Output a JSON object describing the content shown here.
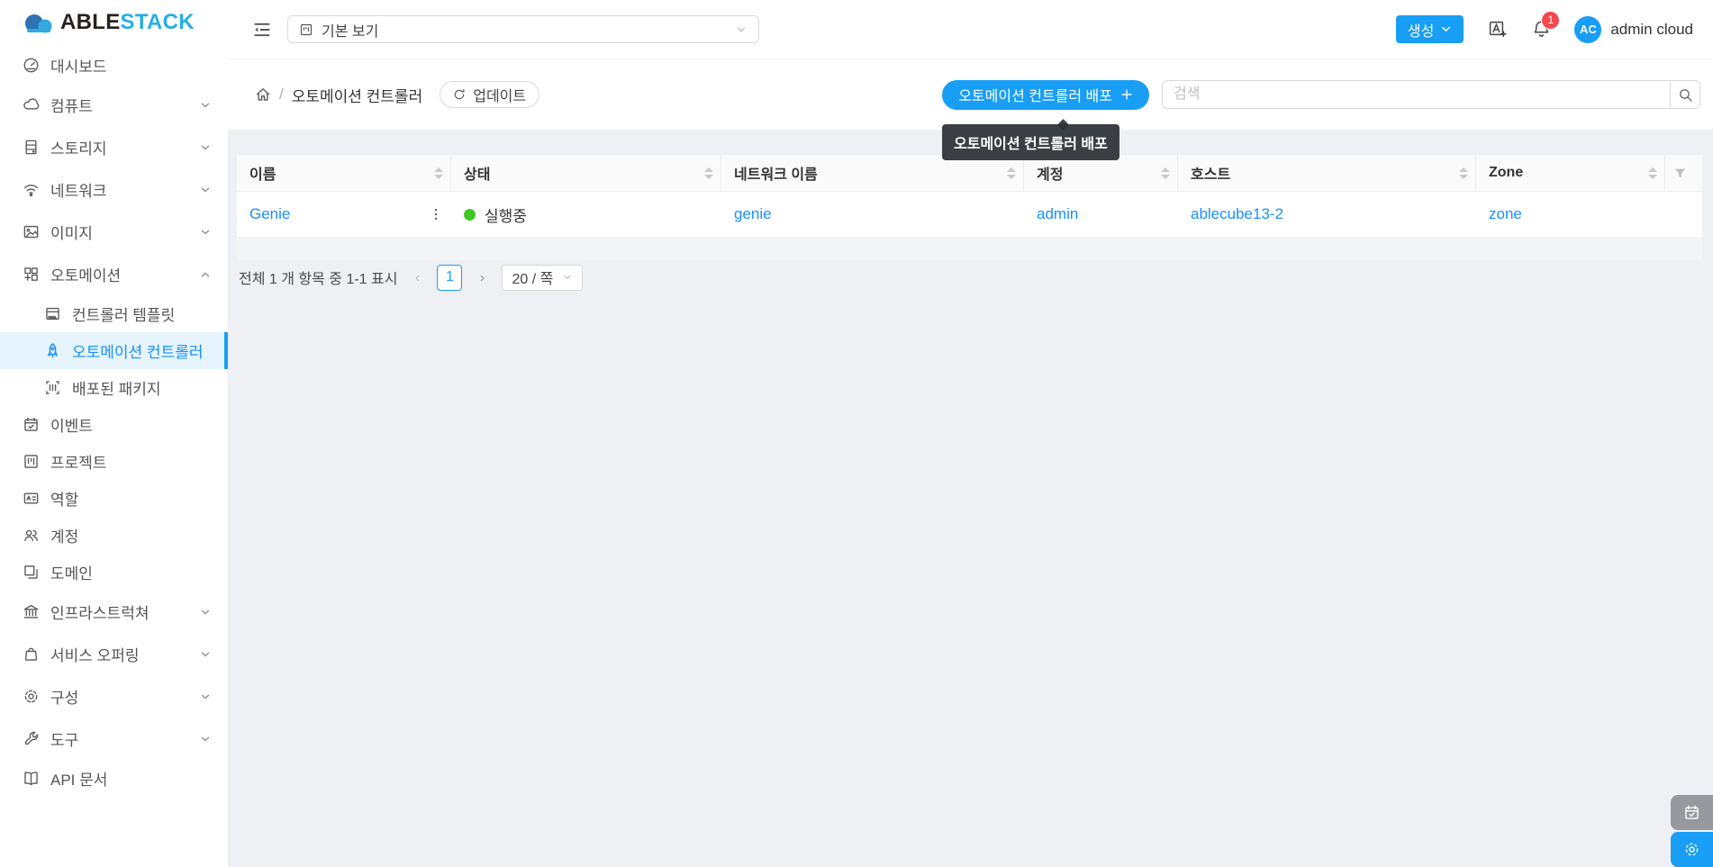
{
  "logo": {
    "able": "ABLE",
    "stack": "STACK"
  },
  "header": {
    "view_label": "기본 보기",
    "create_label": "생성",
    "badge": "1",
    "avatar": "AC",
    "username": "admin cloud"
  },
  "crumbs": {
    "page": "오토메이션 컨트롤러",
    "update": "업데이트"
  },
  "actions": {
    "deploy": "오토메이션 컨트롤러 배포",
    "tooltip": "오토메이션 컨트롤러 배포",
    "search_placeholder": "검색"
  },
  "sidebar": {
    "items": [
      {
        "key": "dashboard",
        "label": "대시보드",
        "icon": "dashboard-icon",
        "type": "leaf"
      },
      {
        "key": "compute",
        "label": "컴퓨트",
        "icon": "cloud-icon",
        "type": "group",
        "chevron": "down"
      },
      {
        "key": "storage",
        "label": "스토리지",
        "icon": "storage-icon",
        "type": "group",
        "chevron": "down"
      },
      {
        "key": "network",
        "label": "네트워크",
        "icon": "wifi-icon",
        "type": "group",
        "chevron": "down"
      },
      {
        "key": "images",
        "label": "이미지",
        "icon": "picture-icon",
        "type": "group",
        "chevron": "down"
      },
      {
        "key": "automation",
        "label": "오토메이션",
        "icon": "automation-icon",
        "type": "group",
        "chevron": "up"
      },
      {
        "key": "controller-templates",
        "label": "컨트롤러 템플릿",
        "icon": "template-icon",
        "type": "sub"
      },
      {
        "key": "automation-controllers",
        "label": "오토메이션 컨트롤러",
        "icon": "rocket-icon",
        "type": "sub",
        "selected": true
      },
      {
        "key": "deployed-packages",
        "label": "배포된 패키지",
        "icon": "package-icon",
        "type": "sub"
      },
      {
        "key": "events",
        "label": "이벤트",
        "icon": "calendar-icon",
        "type": "leaf"
      },
      {
        "key": "projects",
        "label": "프로젝트",
        "icon": "project-icon",
        "type": "leaf"
      },
      {
        "key": "roles",
        "label": "역할",
        "icon": "idcard-icon",
        "type": "leaf"
      },
      {
        "key": "accounts",
        "label": "계정",
        "icon": "team-icon",
        "type": "leaf"
      },
      {
        "key": "domains",
        "label": "도메인",
        "icon": "domain-icon",
        "type": "leaf"
      },
      {
        "key": "infrastructure",
        "label": "인프라스트럭쳐",
        "icon": "bank-icon",
        "type": "group",
        "chevron": "down"
      },
      {
        "key": "service-offerings",
        "label": "서비스 오퍼링",
        "icon": "bag-icon",
        "type": "group",
        "chevron": "down"
      },
      {
        "key": "configuration",
        "label": "구성",
        "icon": "gear-icon",
        "type": "group",
        "chevron": "down"
      },
      {
        "key": "tools",
        "label": "도구",
        "icon": "wrench-icon",
        "type": "group",
        "chevron": "down"
      },
      {
        "key": "api-docs",
        "label": "API 문서",
        "icon": "book-icon",
        "type": "leaf"
      }
    ]
  },
  "table": {
    "columns": [
      {
        "label": "이름",
        "sortable": true
      },
      {
        "label": "상태",
        "sortable": true
      },
      {
        "label": "네트워크 이름",
        "sortable": true
      },
      {
        "label": "계정",
        "sortable": true
      },
      {
        "label": "호스트",
        "sortable": true
      },
      {
        "label": "Zone",
        "sortable": true
      }
    ],
    "rows": [
      {
        "name": "Genie",
        "status": "실행중",
        "network": "genie",
        "account": "admin",
        "host": "ablecube13-2",
        "zone": "zone"
      }
    ]
  },
  "pager": {
    "summary": "전체 1 개 항목 중 1-1 표시",
    "prev": "‹",
    "page": "1",
    "next": "›",
    "size": "20 / 쪽"
  },
  "colors": {
    "accent": "#189ef5",
    "link": "#1890ff",
    "running_green": "#3fc723",
    "badge_red": "#f5484e",
    "page_bg": "#eef0f4"
  }
}
